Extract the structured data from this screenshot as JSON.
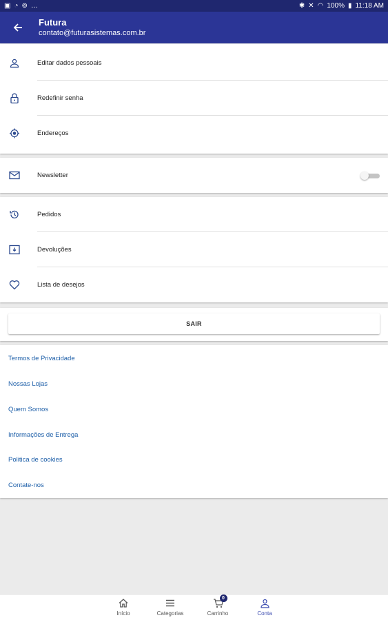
{
  "status_bar": {
    "battery": "100%",
    "time": "11:18 AM"
  },
  "app_bar": {
    "title": "Futura",
    "subtitle": "contato@futurasistemas.com.br"
  },
  "account_menu": [
    {
      "label": "Editar dados pessoais",
      "icon": "person-icon"
    },
    {
      "label": "Redefinir senha",
      "icon": "lock-icon"
    },
    {
      "label": "Endereços",
      "icon": "location-icon"
    }
  ],
  "newsletter": {
    "label": "Newsletter",
    "icon": "mail-icon",
    "enabled": false
  },
  "orders_menu": [
    {
      "label": "Pedidos",
      "icon": "history-icon"
    },
    {
      "label": "Devoluções",
      "icon": "return-box-icon"
    },
    {
      "label": "Lista de desejos",
      "icon": "heart-icon"
    }
  ],
  "logout_label": "SAIR",
  "links": [
    "Termos de Privacidade",
    "Nossas Lojas",
    "Quem Somos",
    "Informações de Entrega",
    "Politica de cookies",
    "Contate-nos"
  ],
  "bottom_nav": [
    {
      "label": "Início",
      "icon": "home-icon"
    },
    {
      "label": "Categorias",
      "icon": "list-icon"
    },
    {
      "label": "Carrinho",
      "icon": "cart-icon",
      "badge": "0"
    },
    {
      "label": "Conta",
      "icon": "account-icon",
      "active": true
    }
  ],
  "colors": {
    "primary": "#2b3596",
    "status_bar": "#1f276f",
    "link": "#1c5ea8",
    "icon": "#2c4a8f"
  }
}
